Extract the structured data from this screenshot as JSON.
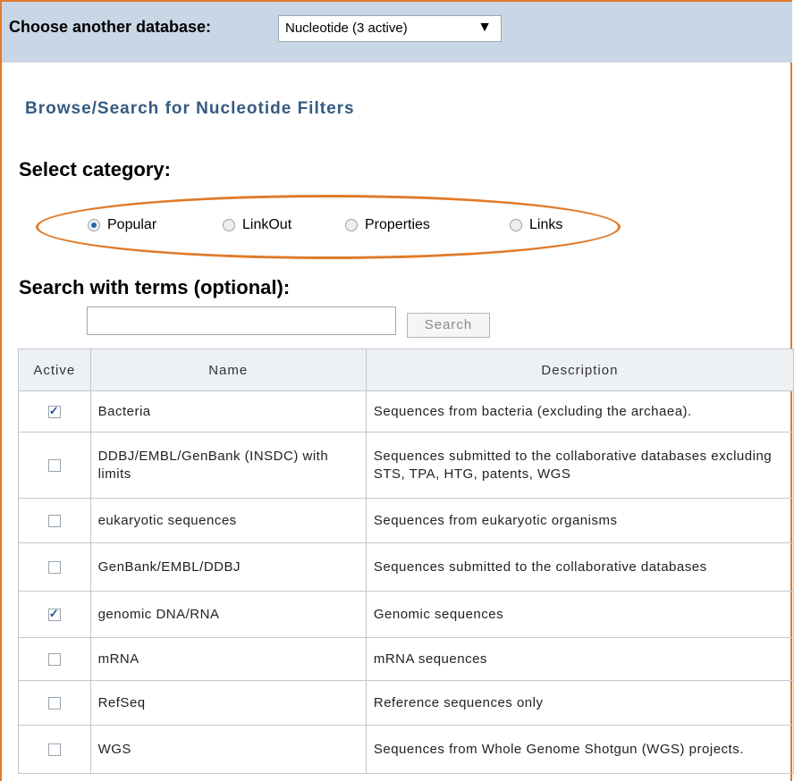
{
  "top_bar": {
    "label": "Choose another database:",
    "database_select": "Nucleotide (3 active)"
  },
  "heading": "Browse/Search for Nucleotide Filters",
  "category": {
    "title": "Select category:",
    "options": [
      {
        "label": "Popular",
        "selected": true
      },
      {
        "label": "LinkOut",
        "selected": false
      },
      {
        "label": "Properties",
        "selected": false
      },
      {
        "label": "Links",
        "selected": false
      }
    ]
  },
  "search": {
    "title": "Search with terms (optional):",
    "input_value": "",
    "button_label": "Search"
  },
  "table": {
    "headers": [
      "Active",
      "Name",
      "Description"
    ],
    "rows": [
      {
        "active": true,
        "name": "Bacteria",
        "description": "Sequences from bacteria (excluding the archaea)."
      },
      {
        "active": false,
        "name": "DDBJ/EMBL/GenBank (INSDC) with limits",
        "description": "Sequences submitted to the collaborative databases excluding STS, TPA, HTG, patents, WGS"
      },
      {
        "active": false,
        "name": "eukaryotic sequences",
        "description": "Sequences from eukaryotic organisms"
      },
      {
        "active": false,
        "name": "GenBank/EMBL/DDBJ",
        "description": "Sequences submitted to the collaborative databases"
      },
      {
        "active": true,
        "name": "genomic DNA/RNA",
        "description": "Genomic sequences"
      },
      {
        "active": false,
        "name": "mRNA",
        "description": "mRNA sequences"
      },
      {
        "active": false,
        "name": "RefSeq",
        "description": "Reference sequences only"
      },
      {
        "active": false,
        "name": "WGS",
        "description": "Sequences from Whole Genome Shotgun (WGS) projects."
      }
    ]
  },
  "colors": {
    "top_bar_bg": "#c9d6e6",
    "heading": "#355a82",
    "highlight_oval": "#e07b2a",
    "radio_selected": "#1f67b1"
  }
}
